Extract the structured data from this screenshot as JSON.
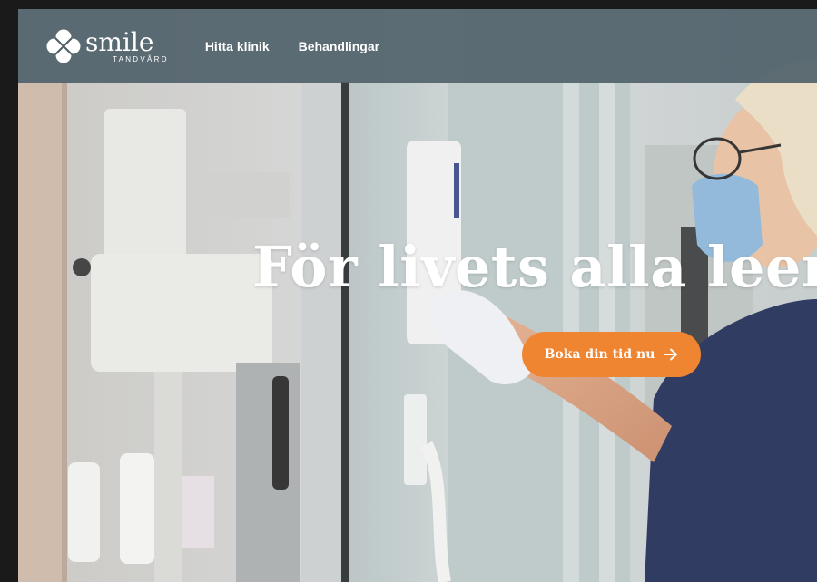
{
  "header": {
    "logo": {
      "name": "smile",
      "subtitle": "TANDVÅRD"
    },
    "nav": [
      {
        "label": "Hitta klinik"
      },
      {
        "label": "Behandlingar"
      }
    ]
  },
  "hero": {
    "headline": "För livets alla leen",
    "cta": {
      "label": "Boka din tid nu",
      "icon": "arrow-right-icon"
    }
  },
  "colors": {
    "header_bg": "#4e5f69",
    "cta": "#ef8431",
    "text": "#ffffff"
  }
}
